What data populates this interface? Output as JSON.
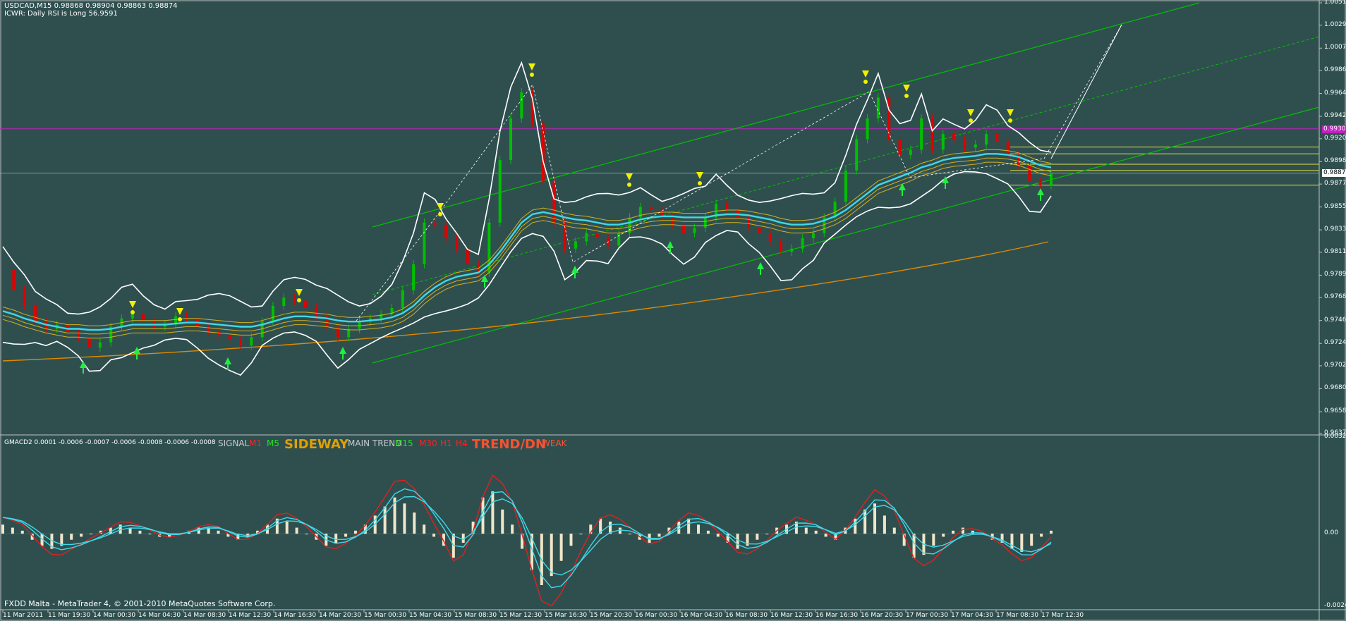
{
  "header": {
    "symbol_line": "USDCAD,M15  0.98868 0.98904 0.98863 0.98874",
    "indicator_line": "ICWR: Daily RSI is Long 56.9591"
  },
  "sub_header": {
    "gmacd_line": "GMACD2 0.0001 -0.0006 -0.0007 -0.0006 -0.0008 -0.0006 -0.0008"
  },
  "signals": {
    "signal": "SIGNAL",
    "m1": "M1",
    "m5": "M5",
    "sideway": "SIDEWAY",
    "main_trend": "MAIN TREND",
    "m15": "M15",
    "m30": "M30",
    "h1": "H1",
    "h4": "H4",
    "trend_dn": "TREND/DN",
    "weak": "WEAK"
  },
  "footer": {
    "copyright": "FXDD Malta - MetaTrader 4, © 2001-2010 MetaQuotes Software Corp."
  },
  "price_tags": {
    "magenta": "0.99300",
    "current": "0.98874"
  },
  "colors": {
    "background": "#2f4f4f",
    "bull": "#00c000",
    "bear": "#e00000",
    "ma_cyan": "#40d8e8",
    "bands": "#ffffff",
    "channel": "#00c000",
    "gold": "#d4b020",
    "orange_ma": "#e08a00",
    "magenta_line": "#c020c0",
    "histogram": "#f0e6c8"
  },
  "chart_data": [
    {
      "type": "line",
      "title": "USDCAD,M15",
      "xlabel": "",
      "ylabel": "",
      "ylim": [
        0.96375,
        1.0051
      ],
      "y_ticks": [
        "1.00510",
        "1.00295",
        "1.00075",
        "0.99860",
        "0.99640",
        "0.99420",
        "0.99205",
        "0.98985",
        "0.98770",
        "0.98550",
        "0.98330",
        "0.98115",
        "0.97895",
        "0.97680",
        "0.97460",
        "0.97240",
        "0.97025",
        "0.96805",
        "0.96585",
        "0.96375"
      ],
      "x_ticks": [
        "11 Mar 2011",
        "11 Mar 19:30",
        "14 Mar 00:30",
        "14 Mar 04:30",
        "14 Mar 08:30",
        "14 Mar 12:30",
        "14 Mar 16:30",
        "14 Mar 20:30",
        "15 Mar 00:30",
        "15 Mar 04:30",
        "15 Mar 08:30",
        "15 Mar 12:30",
        "15 Mar 16:30",
        "15 Mar 20:30",
        "16 Mar 00:30",
        "16 Mar 04:30",
        "16 Mar 08:30",
        "16 Mar 12:30",
        "16 Mar 16:30",
        "16 Mar 20:30",
        "17 Mar 00:30",
        "17 Mar 04:30",
        "17 Mar 08:30",
        "17 Mar 12:30"
      ],
      "series": [
        {
          "name": "USDCAD",
          "values": [
            0.9795,
            0.9775,
            0.976,
            0.9745,
            0.9738,
            0.9742,
            0.9735,
            0.973,
            0.972,
            0.9725,
            0.974,
            0.9748,
            0.9752,
            0.9745,
            0.974,
            0.9742,
            0.975,
            0.9748,
            0.974,
            0.9735,
            0.9732,
            0.9728,
            0.9722,
            0.973,
            0.9745,
            0.976,
            0.9768,
            0.9765,
            0.9758,
            0.975,
            0.974,
            0.973,
            0.9738,
            0.9745,
            0.9748,
            0.9752,
            0.9758,
            0.9775,
            0.98,
            0.984,
            0.9838,
            0.9825,
            0.9815,
            0.98,
            0.9792,
            0.984,
            0.99,
            0.994,
            0.9965,
            0.9935,
            0.988,
            0.984,
            0.9815,
            0.9822,
            0.983,
            0.9825,
            0.9818,
            0.983,
            0.9845,
            0.9855,
            0.9852,
            0.9845,
            0.9838,
            0.983,
            0.9835,
            0.9845,
            0.9858,
            0.9852,
            0.9845,
            0.9835,
            0.983,
            0.9822,
            0.9812,
            0.9815,
            0.9825,
            0.983,
            0.9845,
            0.986,
            0.989,
            0.992,
            0.994,
            0.996,
            0.992,
            0.9905,
            0.991,
            0.994,
            0.991,
            0.9925,
            0.992,
            0.9912,
            0.9915,
            0.9925,
            0.9918,
            0.9905,
            0.9895,
            0.988,
            0.9876,
            0.9887
          ]
        },
        {
          "name": "",
          "values": [
            0.9755,
            0.9752,
            0.9748,
            0.9745,
            0.9742,
            0.974,
            0.9738,
            0.9738,
            0.9737,
            0.9737,
            0.9738,
            0.974,
            0.9742,
            0.9742,
            0.9742,
            0.9742,
            0.9743,
            0.9744,
            0.9744,
            0.9743,
            0.9742,
            0.9741,
            0.974,
            0.974,
            0.9742,
            0.9745,
            0.9748,
            0.975,
            0.975,
            0.9749,
            0.9748,
            0.9746,
            0.9745,
            0.9745,
            0.9746,
            0.9747,
            0.9749,
            0.9753,
            0.976,
            0.977,
            0.9778,
            0.9784,
            0.9788,
            0.979,
            0.9792,
            0.98,
            0.9812,
            0.9826,
            0.984,
            0.9848,
            0.985,
            0.9848,
            0.9845,
            0.9843,
            0.9842,
            0.984,
            0.9838,
            0.9838,
            0.984,
            0.9843,
            0.9845,
            0.9846,
            0.9846,
            0.9845,
            0.9845,
            0.9845,
            0.9847,
            0.9848,
            0.9848,
            0.9847,
            0.9845,
            0.9843,
            0.984,
            0.9838,
            0.9838,
            0.9839,
            0.9842,
            0.9846,
            0.9852,
            0.986,
            0.9868,
            0.9876,
            0.988,
            0.9884,
            0.9888,
            0.9893,
            0.9896,
            0.99,
            0.9902,
            0.9903,
            0.9904,
            0.9906,
            0.9906,
            0.9905,
            0.9903,
            0.9899,
            0.9895,
            0.9893
          ]
        }
      ]
    },
    {
      "type": "bar",
      "title": "GMACD2",
      "ylim": [
        -0.0024,
        0.0032
      ],
      "y_ticks": [
        "0.0032",
        "0.00",
        "-0.0024"
      ],
      "values": [
        0.0003,
        0.0002,
        0.0001,
        -0.0002,
        -0.0004,
        -0.0005,
        -0.0004,
        -0.0002,
        -0.0001,
        0.0,
        0.0001,
        0.0002,
        0.0003,
        0.0002,
        0.0001,
        0.0,
        -0.0001,
        -0.0001,
        0.0,
        0.0001,
        0.0002,
        0.0002,
        0.0001,
        -0.0001,
        -0.0002,
        -0.0001,
        0.0001,
        0.0003,
        0.0005,
        0.0004,
        0.0002,
        0.0,
        -0.0002,
        -0.0004,
        -0.0003,
        -0.0001,
        0.0001,
        0.0003,
        0.0006,
        0.0009,
        0.0012,
        0.001,
        0.0007,
        0.0003,
        -0.0001,
        -0.0004,
        -0.0008,
        -0.0003,
        0.0004,
        0.0012,
        0.0014,
        0.0008,
        0.0003,
        -0.0005,
        -0.0012,
        -0.0017,
        -0.0014,
        -0.0009,
        -0.0004,
        0.0,
        0.0003,
        0.0005,
        0.0004,
        0.0002,
        0.0,
        -0.0002,
        -0.0003,
        -0.0001,
        0.0002,
        0.0004,
        0.0005,
        0.0003,
        0.0001,
        -0.0001,
        -0.0003,
        -0.0005,
        -0.0004,
        -0.0002,
        0.0,
        0.0002,
        0.0003,
        0.0004,
        0.0002,
        0.0001,
        -0.0001,
        -0.0002,
        0.0002,
        0.0005,
        0.0008,
        0.001,
        0.0006,
        0.0002,
        -0.0004,
        -0.0008,
        -0.0007,
        -0.0004,
        -0.0001,
        0.0001,
        0.0002,
        0.0001,
        0.0,
        -0.0002,
        -0.0003,
        -0.0005,
        -0.0006,
        -0.0004,
        -0.0001,
        0.0001
      ]
    }
  ]
}
